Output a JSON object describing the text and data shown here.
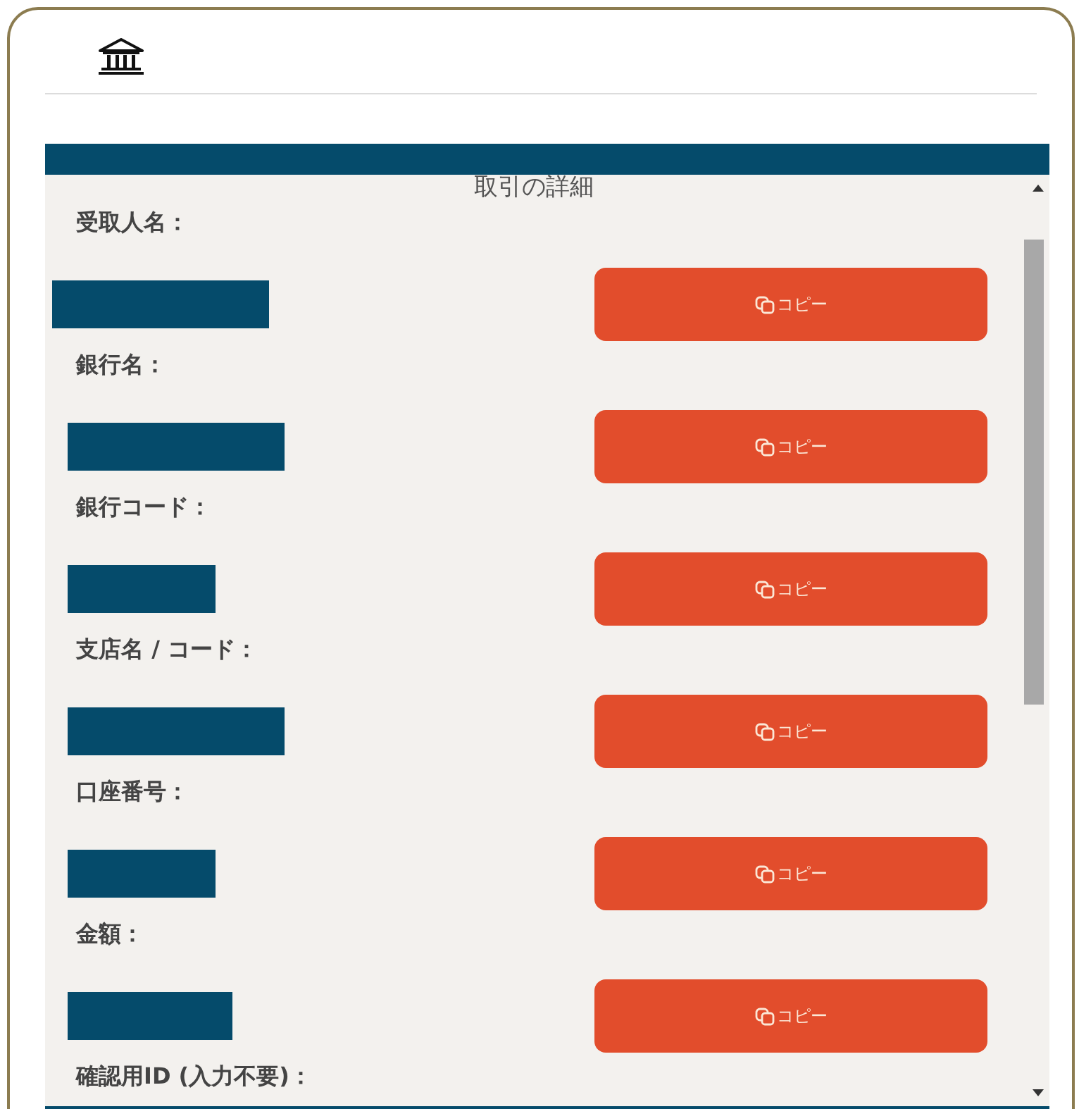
{
  "panel": {
    "title": "取引の詳細",
    "rows": [
      {
        "kind": "redacted",
        "label": "受取人名：",
        "copy_button": "コピー"
      },
      {
        "kind": "redacted",
        "label": "銀行名：",
        "copy_button": "コピー"
      },
      {
        "kind": "redacted",
        "label": "銀行コード：",
        "copy_button": "コピー"
      },
      {
        "kind": "redacted",
        "label": "支店名 / コード：",
        "copy_button": "コピー"
      },
      {
        "kind": "redacted",
        "label": "口座番号：",
        "copy_button": "コピー"
      },
      {
        "kind": "redacted",
        "label": "金額：",
        "copy_button": "コピー"
      },
      {
        "kind": "label_only",
        "label": "確認用ID (入力不要)："
      }
    ]
  }
}
